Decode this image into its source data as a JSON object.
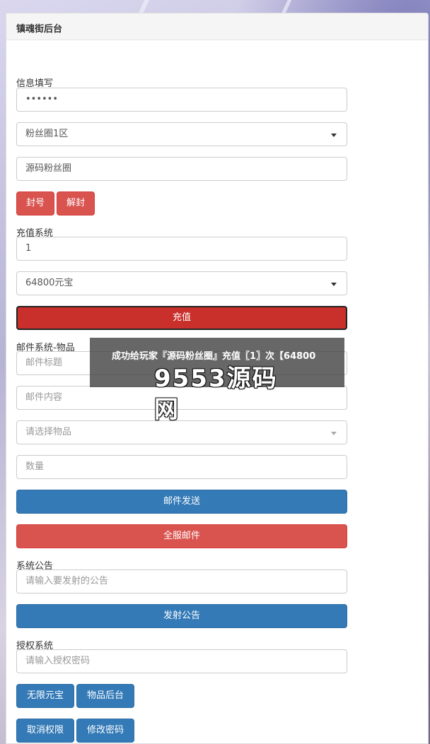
{
  "panel": {
    "title": "镇魂街后台"
  },
  "info": {
    "label": "信息填写",
    "password_value": "••••••",
    "server_select": "粉丝圈1区",
    "player_name": "源码粉丝圈",
    "ban_button": "封号",
    "unban_button": "解封"
  },
  "recharge": {
    "label": "充值系统",
    "count_value": "1",
    "amount_select": "64800元宝",
    "submit_button": "充值"
  },
  "mail": {
    "label": "邮件系统-物品",
    "title_placeholder": "邮件标题",
    "content_placeholder": "邮件内容",
    "item_select_placeholder": "请选择物品",
    "quantity_placeholder": "数量",
    "send_button": "邮件发送",
    "send_all_button": "全服邮件"
  },
  "announcement": {
    "label": "系统公告",
    "input_placeholder": "请输入要发射的公告",
    "submit_button": "发射公告"
  },
  "auth": {
    "label": "授权系统",
    "input_placeholder": "请输入授权密码",
    "unlimited_button": "无限元宝",
    "items_button": "物品后台",
    "revoke_button": "取消权限",
    "change_password_button": "修改密码"
  },
  "toast": {
    "message": "成功给玩家『源码粉丝圈』充值〖1〗次【64800"
  },
  "watermark": {
    "text": "9553源码网"
  },
  "colors": {
    "red": "#d9534f",
    "blue": "#337ab7",
    "dark_red": "#c9302c"
  }
}
